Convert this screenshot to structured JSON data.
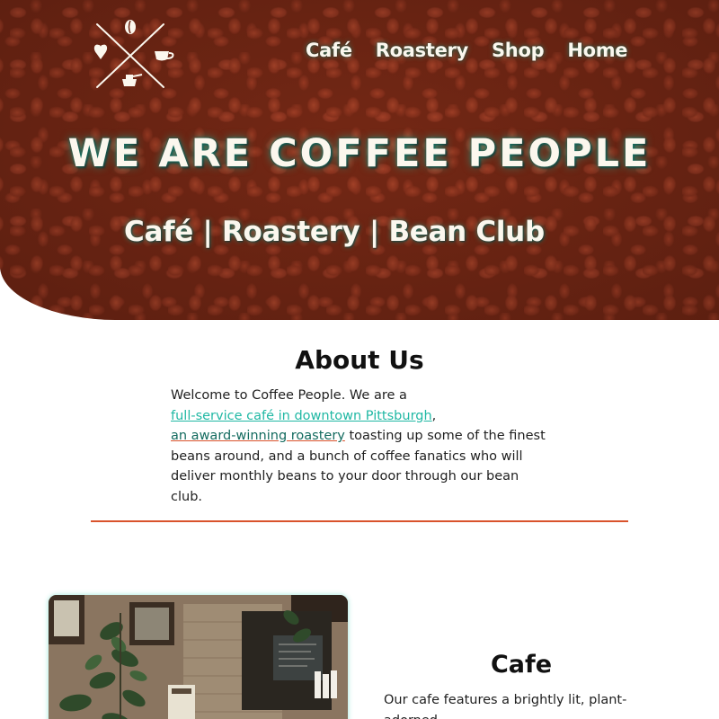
{
  "logo": {
    "icons": [
      "coffee-bean-icon",
      "heart-icon",
      "coffee-cup-icon",
      "coffee-pot-icon"
    ]
  },
  "nav": {
    "items": [
      {
        "label": "Café"
      },
      {
        "label": "Roastery"
      },
      {
        "label": "Shop"
      },
      {
        "label": "Home"
      }
    ]
  },
  "hero": {
    "title": "WE ARE COFFEE PEOPLE",
    "subtitle": "Café | Roastery | Bean Club"
  },
  "about": {
    "title": "About Us",
    "intro": "Welcome to Coffee People. We are a",
    "link_cafe": "full-service café in downtown Pittsburgh",
    "comma": ",",
    "link_roastery": "an award-winning roastery",
    "rest": " toasting up some of the finest beans around, and a bunch of coffee fanatics who will deliver monthly beans to your door through our bean club."
  },
  "cafe": {
    "title": "Cafe",
    "text": "Our cafe features a brightly lit, plant-adorned"
  },
  "colors": {
    "accent": "#d9532c",
    "link": "#20b8a4",
    "link_dark": "#136b5f",
    "glow": "#1ec8aa",
    "hero_bg": "#6e2614"
  }
}
